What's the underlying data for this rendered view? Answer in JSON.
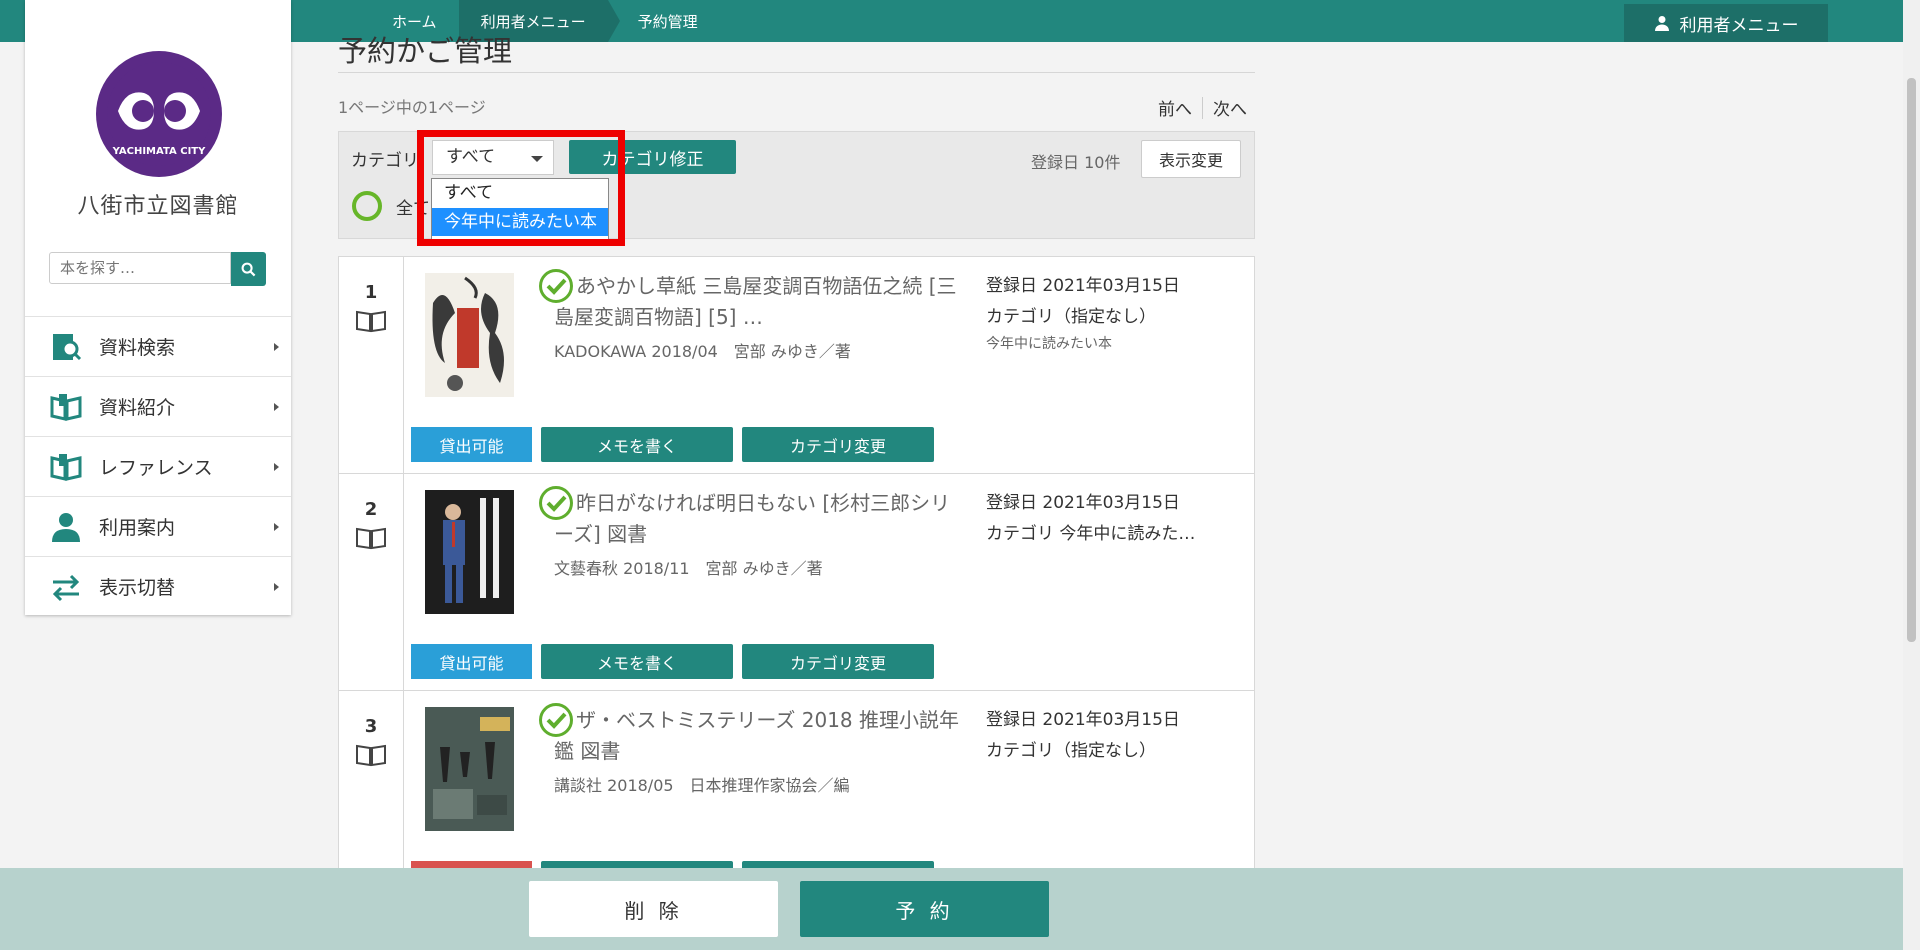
{
  "breadcrumb": [
    "ホーム",
    "利用者メニュー",
    "予約管理"
  ],
  "header": {
    "user_menu_label": "利用者メニュー"
  },
  "sidebar": {
    "library_name": "八街市立図書館",
    "logo_text": "YACHIMATA CITY",
    "search_placeholder": "本を探す…",
    "items": [
      {
        "label": "資料検索",
        "icon": "search-doc-icon"
      },
      {
        "label": "資料紹介",
        "icon": "open-book-icon"
      },
      {
        "label": "レファレンス",
        "icon": "open-book-icon"
      },
      {
        "label": "利用案内",
        "icon": "person-icon"
      },
      {
        "label": "表示切替",
        "icon": "switch-arrows-icon"
      }
    ]
  },
  "main": {
    "title": "予約かご管理",
    "page_info": "1ページ中の1ページ",
    "prev": "前へ",
    "next": "次へ",
    "category_label": "カテゴリ",
    "category_selected": "すべて",
    "category_options": [
      "すべて",
      "今年中に読みたい本"
    ],
    "category_fix_button": "カテゴリ修正",
    "sort_info": "登録日 10件",
    "display_change_button": "表示変更",
    "select_all_label": "全て"
  },
  "books": [
    {
      "num": "1",
      "title": "あやかし草紙 三島屋変調百物語伍之続 [三島屋変調百物語] [5] …",
      "publisher": "KADOKAWA 2018/04　宮部 みゆき／著",
      "registered": "登録日 2021年03月15日",
      "category": "カテゴリ（指定なし）",
      "note": "今年中に読みたい本",
      "status": "貸出可能"
    },
    {
      "num": "2",
      "title": "昨日がなければ明日もない [杉村三郎シリーズ] 図書",
      "publisher": "文藝春秋 2018/11　宮部 みゆき／著",
      "registered": "登録日 2021年03月15日",
      "category": "カテゴリ  今年中に読みた…",
      "note": "",
      "status": "貸出可能"
    },
    {
      "num": "3",
      "title": "ザ・ベストミステリーズ 2018 推理小説年鑑 図書",
      "publisher": "講談社 2018/05　日本推理作家協会／編",
      "registered": "登録日 2021年03月15日",
      "category": "カテゴリ（指定なし）",
      "note": "",
      "status": ""
    }
  ],
  "row_buttons": {
    "memo": "メモを書く",
    "category_change": "カテゴリ変更"
  },
  "footer": {
    "delete": "削 除",
    "reserve": "予 約"
  },
  "colors": {
    "accent": "#22877e",
    "available": "#2a9fd8",
    "highlight": "#ee0000"
  }
}
